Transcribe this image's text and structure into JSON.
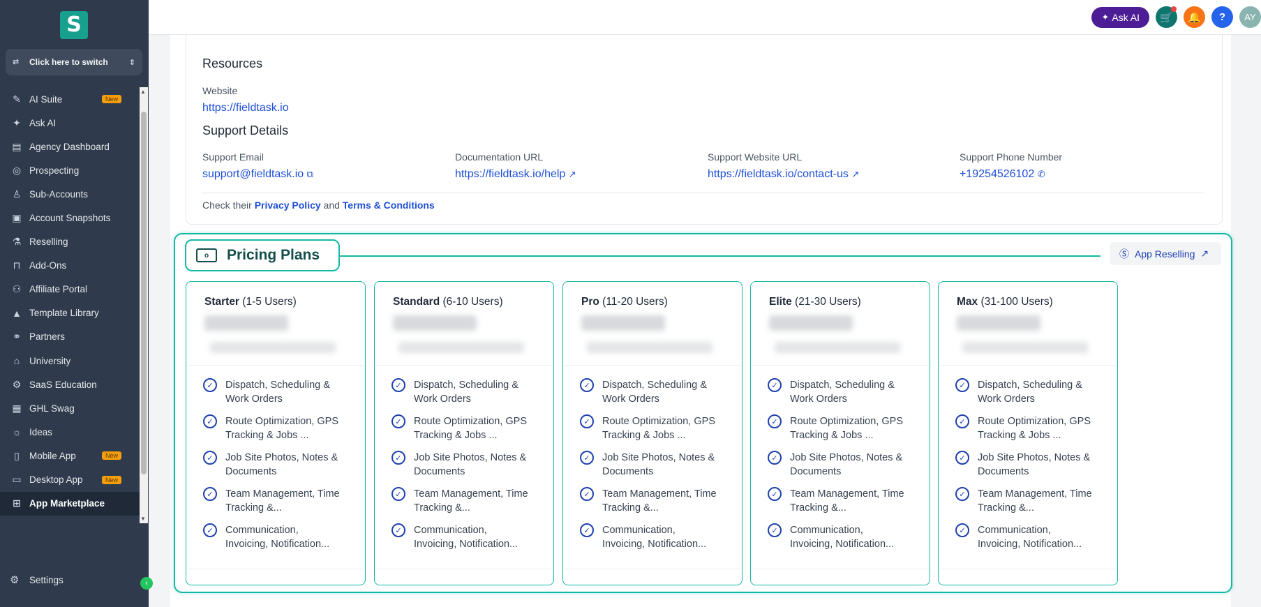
{
  "sidebar": {
    "switcher_label": "Click here to switch",
    "items": [
      {
        "label": "AI Suite",
        "icon": "sparkle-pen-icon",
        "badge": "New"
      },
      {
        "label": "Ask AI",
        "icon": "sparkles-icon",
        "badge": ""
      },
      {
        "label": "Agency Dashboard",
        "icon": "dashboard-icon",
        "badge": ""
      },
      {
        "label": "Prospecting",
        "icon": "prospect-icon",
        "badge": ""
      },
      {
        "label": "Sub-Accounts",
        "icon": "user-icon",
        "badge": ""
      },
      {
        "label": "Account Snapshots",
        "icon": "snapshot-icon",
        "badge": ""
      },
      {
        "label": "Reselling",
        "icon": "reselling-icon",
        "badge": ""
      },
      {
        "label": "Add-Ons",
        "icon": "bag-icon",
        "badge": ""
      },
      {
        "label": "Affiliate Portal",
        "icon": "users-icon",
        "badge": ""
      },
      {
        "label": "Template Library",
        "icon": "shapes-icon",
        "badge": ""
      },
      {
        "label": "Partners",
        "icon": "handshake-icon",
        "badge": ""
      },
      {
        "label": "University",
        "icon": "graduation-cap-icon",
        "badge": ""
      },
      {
        "label": "SaaS Education",
        "icon": "education-icon",
        "badge": ""
      },
      {
        "label": "GHL Swag",
        "icon": "store-icon",
        "badge": ""
      },
      {
        "label": "Ideas",
        "icon": "lightbulb-icon",
        "badge": ""
      },
      {
        "label": "Mobile App",
        "icon": "mobile-icon",
        "badge": "New"
      },
      {
        "label": "Desktop App",
        "icon": "desktop-icon",
        "badge": "New"
      },
      {
        "label": "App Marketplace",
        "icon": "grid-icon",
        "badge": ""
      }
    ],
    "settings_label": "Settings"
  },
  "topbar": {
    "ask_ai_label": "Ask AI",
    "avatar_initials": "AY",
    "help_label": "?"
  },
  "resources": {
    "heading": "Resources",
    "website_label": "Website",
    "website_url": "https://fieldtask.io"
  },
  "support": {
    "heading": "Support Details",
    "email_label": "Support Email",
    "email": "support@fieldtask.io",
    "docs_label": "Documentation URL",
    "docs_url": "https://fieldtask.io/help",
    "website_label": "Support Website URL",
    "website_url": "https://fieldtask.io/contact-us",
    "phone_label": "Support Phone Number",
    "phone": "+19254526102",
    "check_prefix": "Check their",
    "privacy_label": "Privacy Policy",
    "and_text": "and",
    "terms_label": "Terms & Conditions"
  },
  "pricing": {
    "title": "Pricing Plans",
    "reselling_label": "App Reselling",
    "plans": [
      {
        "name": "Starter",
        "users": "(1-5 Users)"
      },
      {
        "name": "Standard",
        "users": "(6-10 Users)"
      },
      {
        "name": "Pro",
        "users": "(11-20 Users)"
      },
      {
        "name": "Elite",
        "users": "(21-30 Users)"
      },
      {
        "name": "Max",
        "users": "(31-100 Users)"
      }
    ],
    "features": [
      "Dispatch, Scheduling & Work Orders",
      "Route Optimization, GPS Tracking & Jobs ...",
      "Job Site Photos, Notes & Documents",
      "Team Management, Time Tracking &...",
      "Communication, Invoicing, Notification..."
    ]
  }
}
